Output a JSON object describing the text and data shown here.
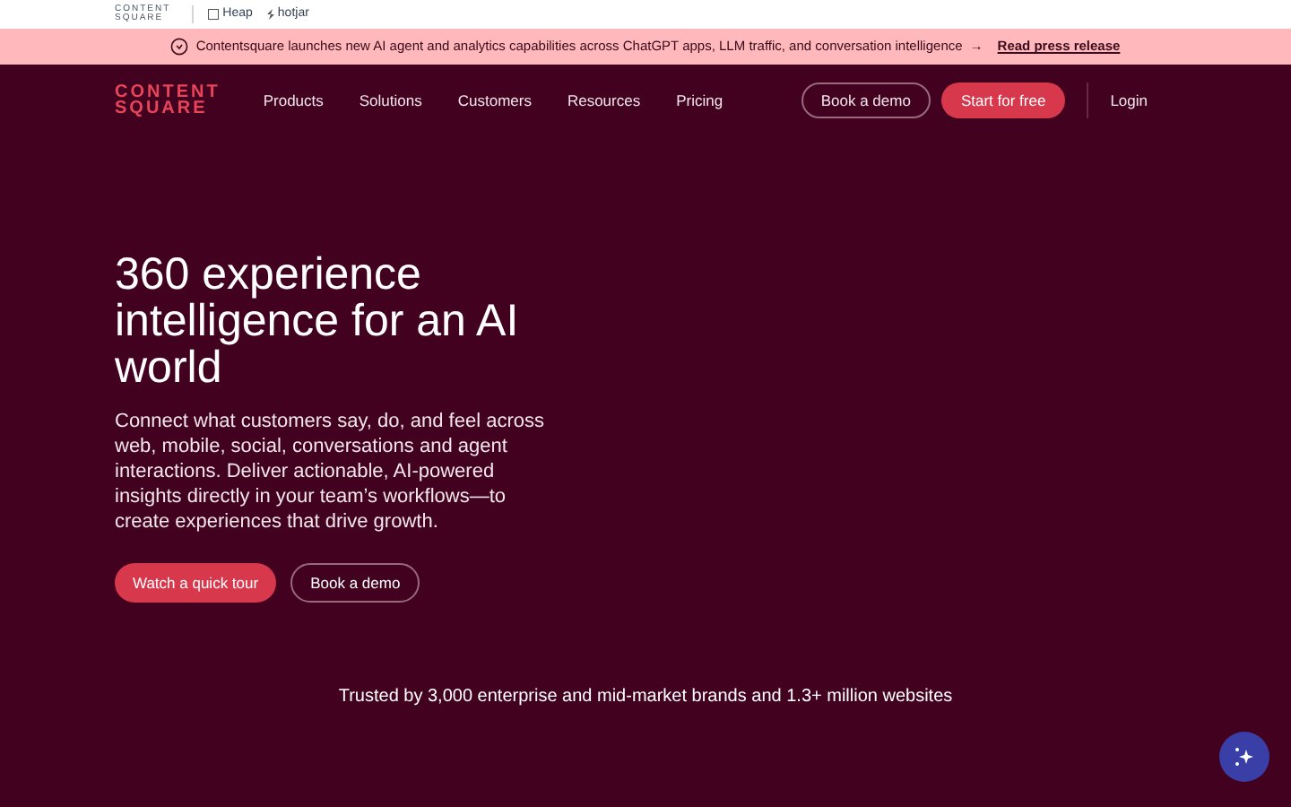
{
  "brand_bar": {
    "brands": [
      {
        "kind": "contentsquare",
        "lines": [
          "CONTENT",
          "SQUARE"
        ]
      },
      {
        "kind": "heap",
        "label": "Heap"
      },
      {
        "kind": "hotjar",
        "label": "hotjar"
      }
    ]
  },
  "announcement": {
    "text": "Contentsquare launches new AI agent and analytics capabilities across ChatGPT apps, LLM traffic, and conversation intelligence",
    "arrow": "→",
    "link": "Read press release"
  },
  "nav": {
    "logo": [
      "CONTENT",
      "SQUARE"
    ],
    "items": [
      "Products",
      "Solutions",
      "Customers",
      "Resources",
      "Pricing"
    ],
    "demo": "Book a demo",
    "start": "Start for free",
    "login": "Login"
  },
  "hero": {
    "title": "360 experience intelligence for an AI world",
    "body": "Connect what customers say, do, and feel across web, mobile, social, conversations and agent interactions. Deliver actionable, AI-powered insights directly in your team’s workflows—to create experiences that drive growth.",
    "primary": "Watch a quick tour",
    "secondary": "Book a demo"
  },
  "trusted": "Trusted by 3,000 enterprise and mid-market brands and 1.3+ million websites"
}
